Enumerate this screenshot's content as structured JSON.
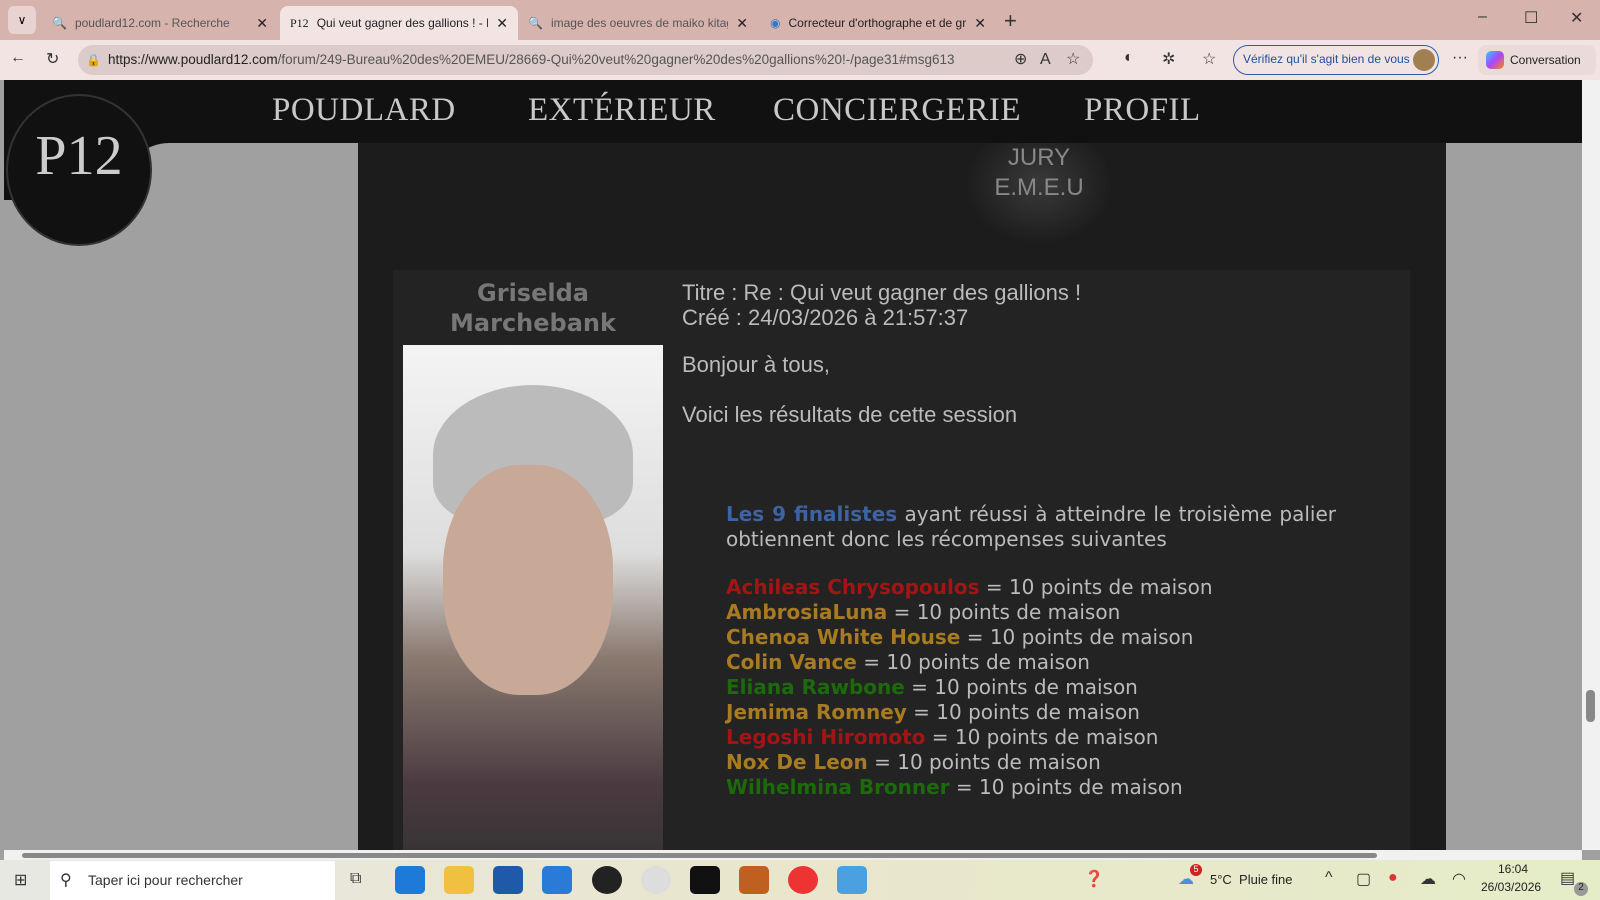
{
  "browser": {
    "tabs": [
      {
        "label": "poudlard12.com - Recherche",
        "icon": "search-icon",
        "active": false
      },
      {
        "label": "Qui veut gagner des gallions ! - Bu",
        "icon": "p12-favicon",
        "active": true
      },
      {
        "label": "image des oeuvres de maiko kitag",
        "icon": "search-icon",
        "active": false
      },
      {
        "label": "Correcteur d'orthographe et de gr",
        "icon": "corrector-favicon",
        "active": false
      }
    ],
    "url_host": "https://www.poudlard12.com",
    "url_path": "/forum/249-Bureau%20des%20EMEU/28669-Qui%20veut%20gagner%20des%20gallions%20!-/page31#msg613",
    "verify_label": "Vérifiez qu'il s'agit bien de vous",
    "copilot_label": "Conversation",
    "favicon_text": "P12"
  },
  "site": {
    "logo_text": "P12",
    "nav": [
      "POUDLARD",
      "EXTÉRIEUR",
      "CONCIERGERIE",
      "PROFIL"
    ],
    "seal_text": [
      "JURY",
      "E.M.E.U"
    ]
  },
  "post": {
    "author": "Griselda Marchebank",
    "title": "Titre : Re : Qui veut gagner des gallions !",
    "created": "Créé : 24/03/2026 à 21:57:37",
    "greeting": "Bonjour à tous,",
    "intro": "Voici les résultats de cette session",
    "finalists_highlight": "Les 9 finalistes",
    "finalists_text": " ayant réussi à atteindre le troisième palier obtiennent donc les récompenses suivantes",
    "reward": " = 10 points de maison",
    "colors": {
      "red": "#a31515",
      "gold": "#a87b22",
      "green": "#1c6a0c",
      "blue": "#3c63a5"
    },
    "winners": [
      {
        "name": "Achileas Chrysopoulos",
        "color": "#a31515"
      },
      {
        "name": "AmbrosiaLuna",
        "color": "#a87b22"
      },
      {
        "name": "Chenoa White House",
        "color": "#a87b22"
      },
      {
        "name": "Colin Vance",
        "color": "#a87b22"
      },
      {
        "name": "Eliana Rawbone",
        "color": "#1c6a0c"
      },
      {
        "name": "Jemima Romney",
        "color": "#a87b22"
      },
      {
        "name": "Legoshi Hiromoto",
        "color": "#a31515"
      },
      {
        "name": "Nox De Leon",
        "color": "#a87b22"
      },
      {
        "name": "Wilhelmina Bronner",
        "color": "#1c6a0c"
      }
    ]
  },
  "taskbar": {
    "search_placeholder": "Taper ici pour rechercher",
    "weather": "5°C  Pluie fine",
    "weather_badge": "5",
    "time": "16:04",
    "date": "26/03/2026",
    "notif_count": "2"
  }
}
